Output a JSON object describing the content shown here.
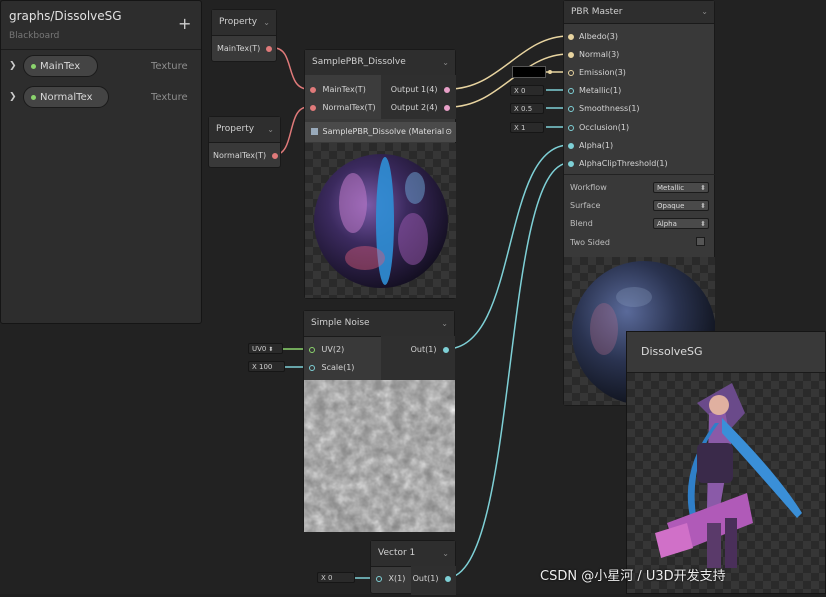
{
  "blackboard": {
    "title": "graphs/DissolveSG",
    "subtitle": "Blackboard",
    "add_label": "+",
    "properties": [
      {
        "name": "MainTex",
        "type": "Texture"
      },
      {
        "name": "NormalTex",
        "type": "Texture"
      }
    ]
  },
  "property_node_1": {
    "title": "Property",
    "port": "MainTex(T)"
  },
  "property_node_2": {
    "title": "Property",
    "port": "NormalTex(T)"
  },
  "subgraph_node": {
    "title": "SamplePBR_Dissolve",
    "inputs": [
      "MainTex(T)",
      "NormalTex(T)"
    ],
    "outputs": [
      "Output 1(4)",
      "Output 2(4)"
    ],
    "material_label": "SamplePBR_Dissolve (Material"
  },
  "noise_node": {
    "title": "Simple Noise",
    "inputs": [
      "UV(2)",
      "Scale(1)"
    ],
    "output": "Out(1)",
    "uv_field": "UV0",
    "scale_field": "X 100"
  },
  "vector_node": {
    "title": "Vector 1",
    "input": "X(1)",
    "output": "Out(1)",
    "x_field": "X 0"
  },
  "master_node": {
    "title": "PBR Master",
    "ports": [
      "Albedo(3)",
      "Normal(3)",
      "Emission(3)",
      "Metallic(1)",
      "Smoothness(1)",
      "Occlusion(1)",
      "Alpha(1)",
      "AlphaClipThreshold(1)"
    ],
    "fields": {
      "metallic": "X 0",
      "smoothness": "X 0.5",
      "occlusion": "X 1"
    },
    "settings": [
      {
        "label": "Workflow",
        "value": "Metallic"
      },
      {
        "label": "Surface",
        "value": "Opaque"
      },
      {
        "label": "Blend",
        "value": "Alpha"
      },
      {
        "label": "Two Sided",
        "value": ""
      }
    ]
  },
  "preview_window": {
    "title": "DissolveSG"
  },
  "watermark": "CSDN @小星河 / U3D开发支持"
}
